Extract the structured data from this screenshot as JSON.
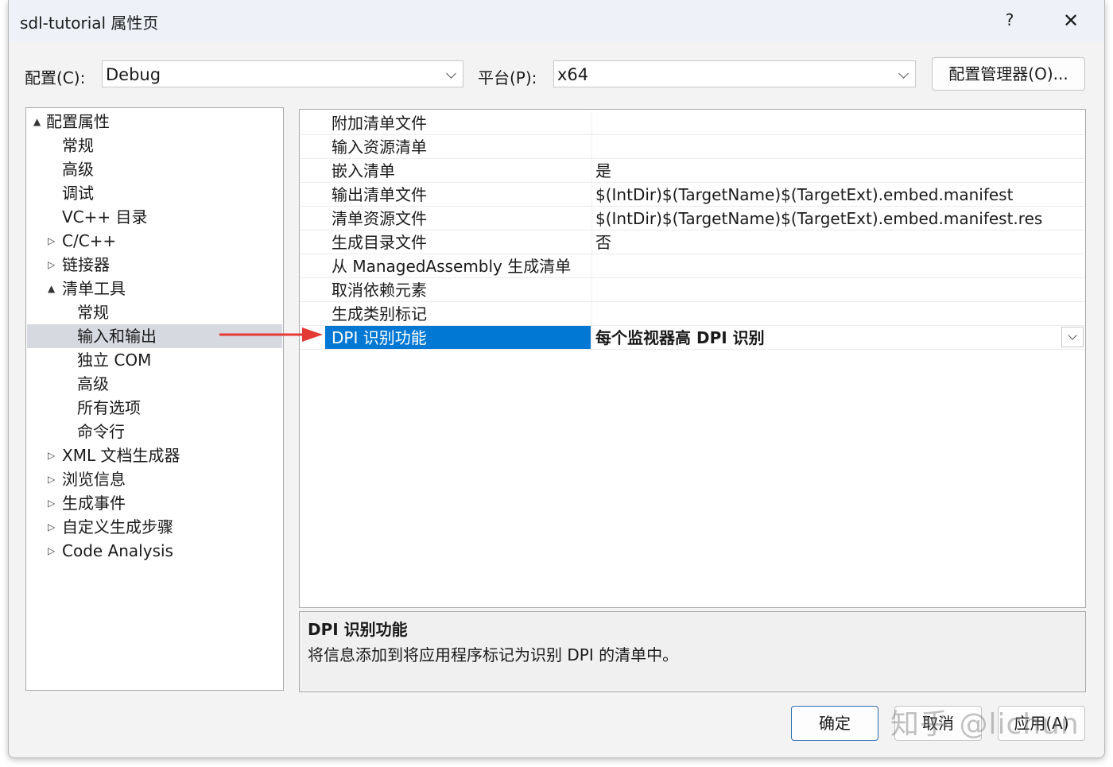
{
  "window": {
    "title": "sdl-tutorial 属性页",
    "help_label": "?",
    "close_label": "✕"
  },
  "toolbar": {
    "config_label": "配置(C):",
    "config_value": "Debug",
    "platform_label": "平台(P):",
    "platform_value": "x64",
    "config_manager_label": "配置管理器(O)..."
  },
  "tree": {
    "items": [
      {
        "label": "配置属性",
        "expander": "▲",
        "selected": false
      },
      {
        "label": "常规",
        "expander": "",
        "selected": false
      },
      {
        "label": "高级",
        "expander": "",
        "selected": false
      },
      {
        "label": "调试",
        "expander": "",
        "selected": false
      },
      {
        "label": "VC++ 目录",
        "expander": "",
        "selected": false
      },
      {
        "label": "C/C++",
        "expander": "▷",
        "selected": false
      },
      {
        "label": "链接器",
        "expander": "▷",
        "selected": false
      },
      {
        "label": "清单工具",
        "expander": "▲",
        "selected": false
      },
      {
        "label": "常规",
        "expander": "",
        "selected": false
      },
      {
        "label": "输入和输出",
        "expander": "",
        "selected": true
      },
      {
        "label": "独立 COM",
        "expander": "",
        "selected": false
      },
      {
        "label": "高级",
        "expander": "",
        "selected": false
      },
      {
        "label": "所有选项",
        "expander": "",
        "selected": false
      },
      {
        "label": "命令行",
        "expander": "",
        "selected": false
      },
      {
        "label": "XML 文档生成器",
        "expander": "▷",
        "selected": false
      },
      {
        "label": "浏览信息",
        "expander": "▷",
        "selected": false
      },
      {
        "label": "生成事件",
        "expander": "▷",
        "selected": false
      },
      {
        "label": "自定义生成步骤",
        "expander": "▷",
        "selected": false
      },
      {
        "label": "Code Analysis",
        "expander": "▷",
        "selected": false
      }
    ]
  },
  "properties": {
    "rows": [
      {
        "name": "附加清单文件",
        "value": ""
      },
      {
        "name": "输入资源清单",
        "value": ""
      },
      {
        "name": "嵌入清单",
        "value": "是"
      },
      {
        "name": "输出清单文件",
        "value": "$(IntDir)$(TargetName)$(TargetExt).embed.manifest"
      },
      {
        "name": "清单资源文件",
        "value": "$(IntDir)$(TargetName)$(TargetExt).embed.manifest.res"
      },
      {
        "name": "生成目录文件",
        "value": "否"
      },
      {
        "name": "从 ManagedAssembly 生成清单",
        "value": ""
      },
      {
        "name": "取消依赖元素",
        "value": ""
      },
      {
        "name": "生成类别标记",
        "value": ""
      },
      {
        "name": "DPI 识别功能",
        "value": "每个监视器高 DPI 识别"
      }
    ]
  },
  "description": {
    "title": "DPI 识别功能",
    "text": "将信息添加到将应用程序标记为识别 DPI 的清单中。"
  },
  "buttons": {
    "ok": "确定",
    "cancel": "取消",
    "apply": "应用(A)"
  },
  "watermark": "知乎 @lichun",
  "colors": {
    "selection": "#0078d4",
    "annotation_arrow": "#e53935"
  }
}
